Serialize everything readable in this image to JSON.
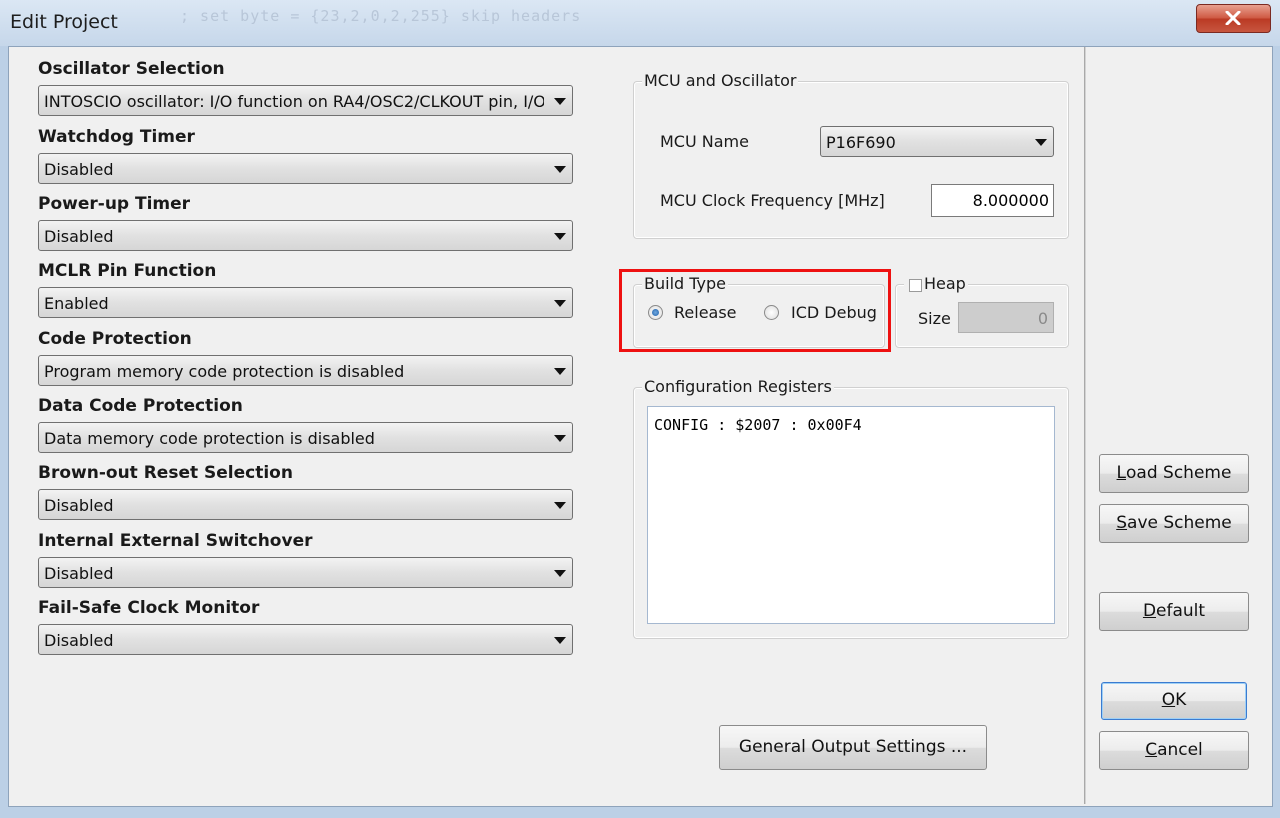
{
  "window": {
    "title": "Edit Project",
    "background_code": "; set byte = {23,2,0,2,255} skip headers"
  },
  "config_fields": [
    {
      "label": "Oscillator Selection",
      "value": "INTOSCIO oscillator: I/O function on RA4/OSC2/CLKOUT pin, I/O"
    },
    {
      "label": "Watchdog Timer",
      "value": "Disabled"
    },
    {
      "label": "Power-up Timer",
      "value": "Disabled"
    },
    {
      "label": "MCLR Pin Function",
      "value": "Enabled"
    },
    {
      "label": "Code Protection",
      "value": "Program memory code protection is disabled"
    },
    {
      "label": "Data Code Protection",
      "value": "Data memory code protection is disabled"
    },
    {
      "label": "Brown-out Reset Selection",
      "value": "Disabled"
    },
    {
      "label": "Internal External Switchover",
      "value": "Disabled"
    },
    {
      "label": "Fail-Safe Clock Monitor",
      "value": "Disabled"
    }
  ],
  "mcu": {
    "group_label": "MCU and Oscillator",
    "name_label": "MCU Name",
    "name_value": "P16F690",
    "clock_label": "MCU Clock Frequency [MHz]",
    "clock_value": "8.000000"
  },
  "build_type": {
    "group_label": "Build Type",
    "release_label": "Release",
    "icd_label": "ICD Debug",
    "selected": "Release"
  },
  "heap": {
    "label": "Heap",
    "size_label": "Size",
    "size_value": "0",
    "checked": false
  },
  "config_registers": {
    "group_label": "Configuration Registers",
    "text": "CONFIG : $2007 : 0x00F4"
  },
  "buttons": {
    "general_output": "General Output Settings ...",
    "load_scheme": {
      "pre": "",
      "u": "L",
      "post": "oad Scheme"
    },
    "save_scheme": {
      "pre": "",
      "u": "S",
      "post": "ave Scheme"
    },
    "default": {
      "pre": "",
      "u": "D",
      "post": "efault"
    },
    "ok": {
      "pre": "",
      "u": "O",
      "post": "K"
    },
    "cancel": {
      "pre": "",
      "u": "C",
      "post": "ancel"
    }
  },
  "colors": {
    "highlight": "#ee1111",
    "accent": "#1f5fa8"
  }
}
